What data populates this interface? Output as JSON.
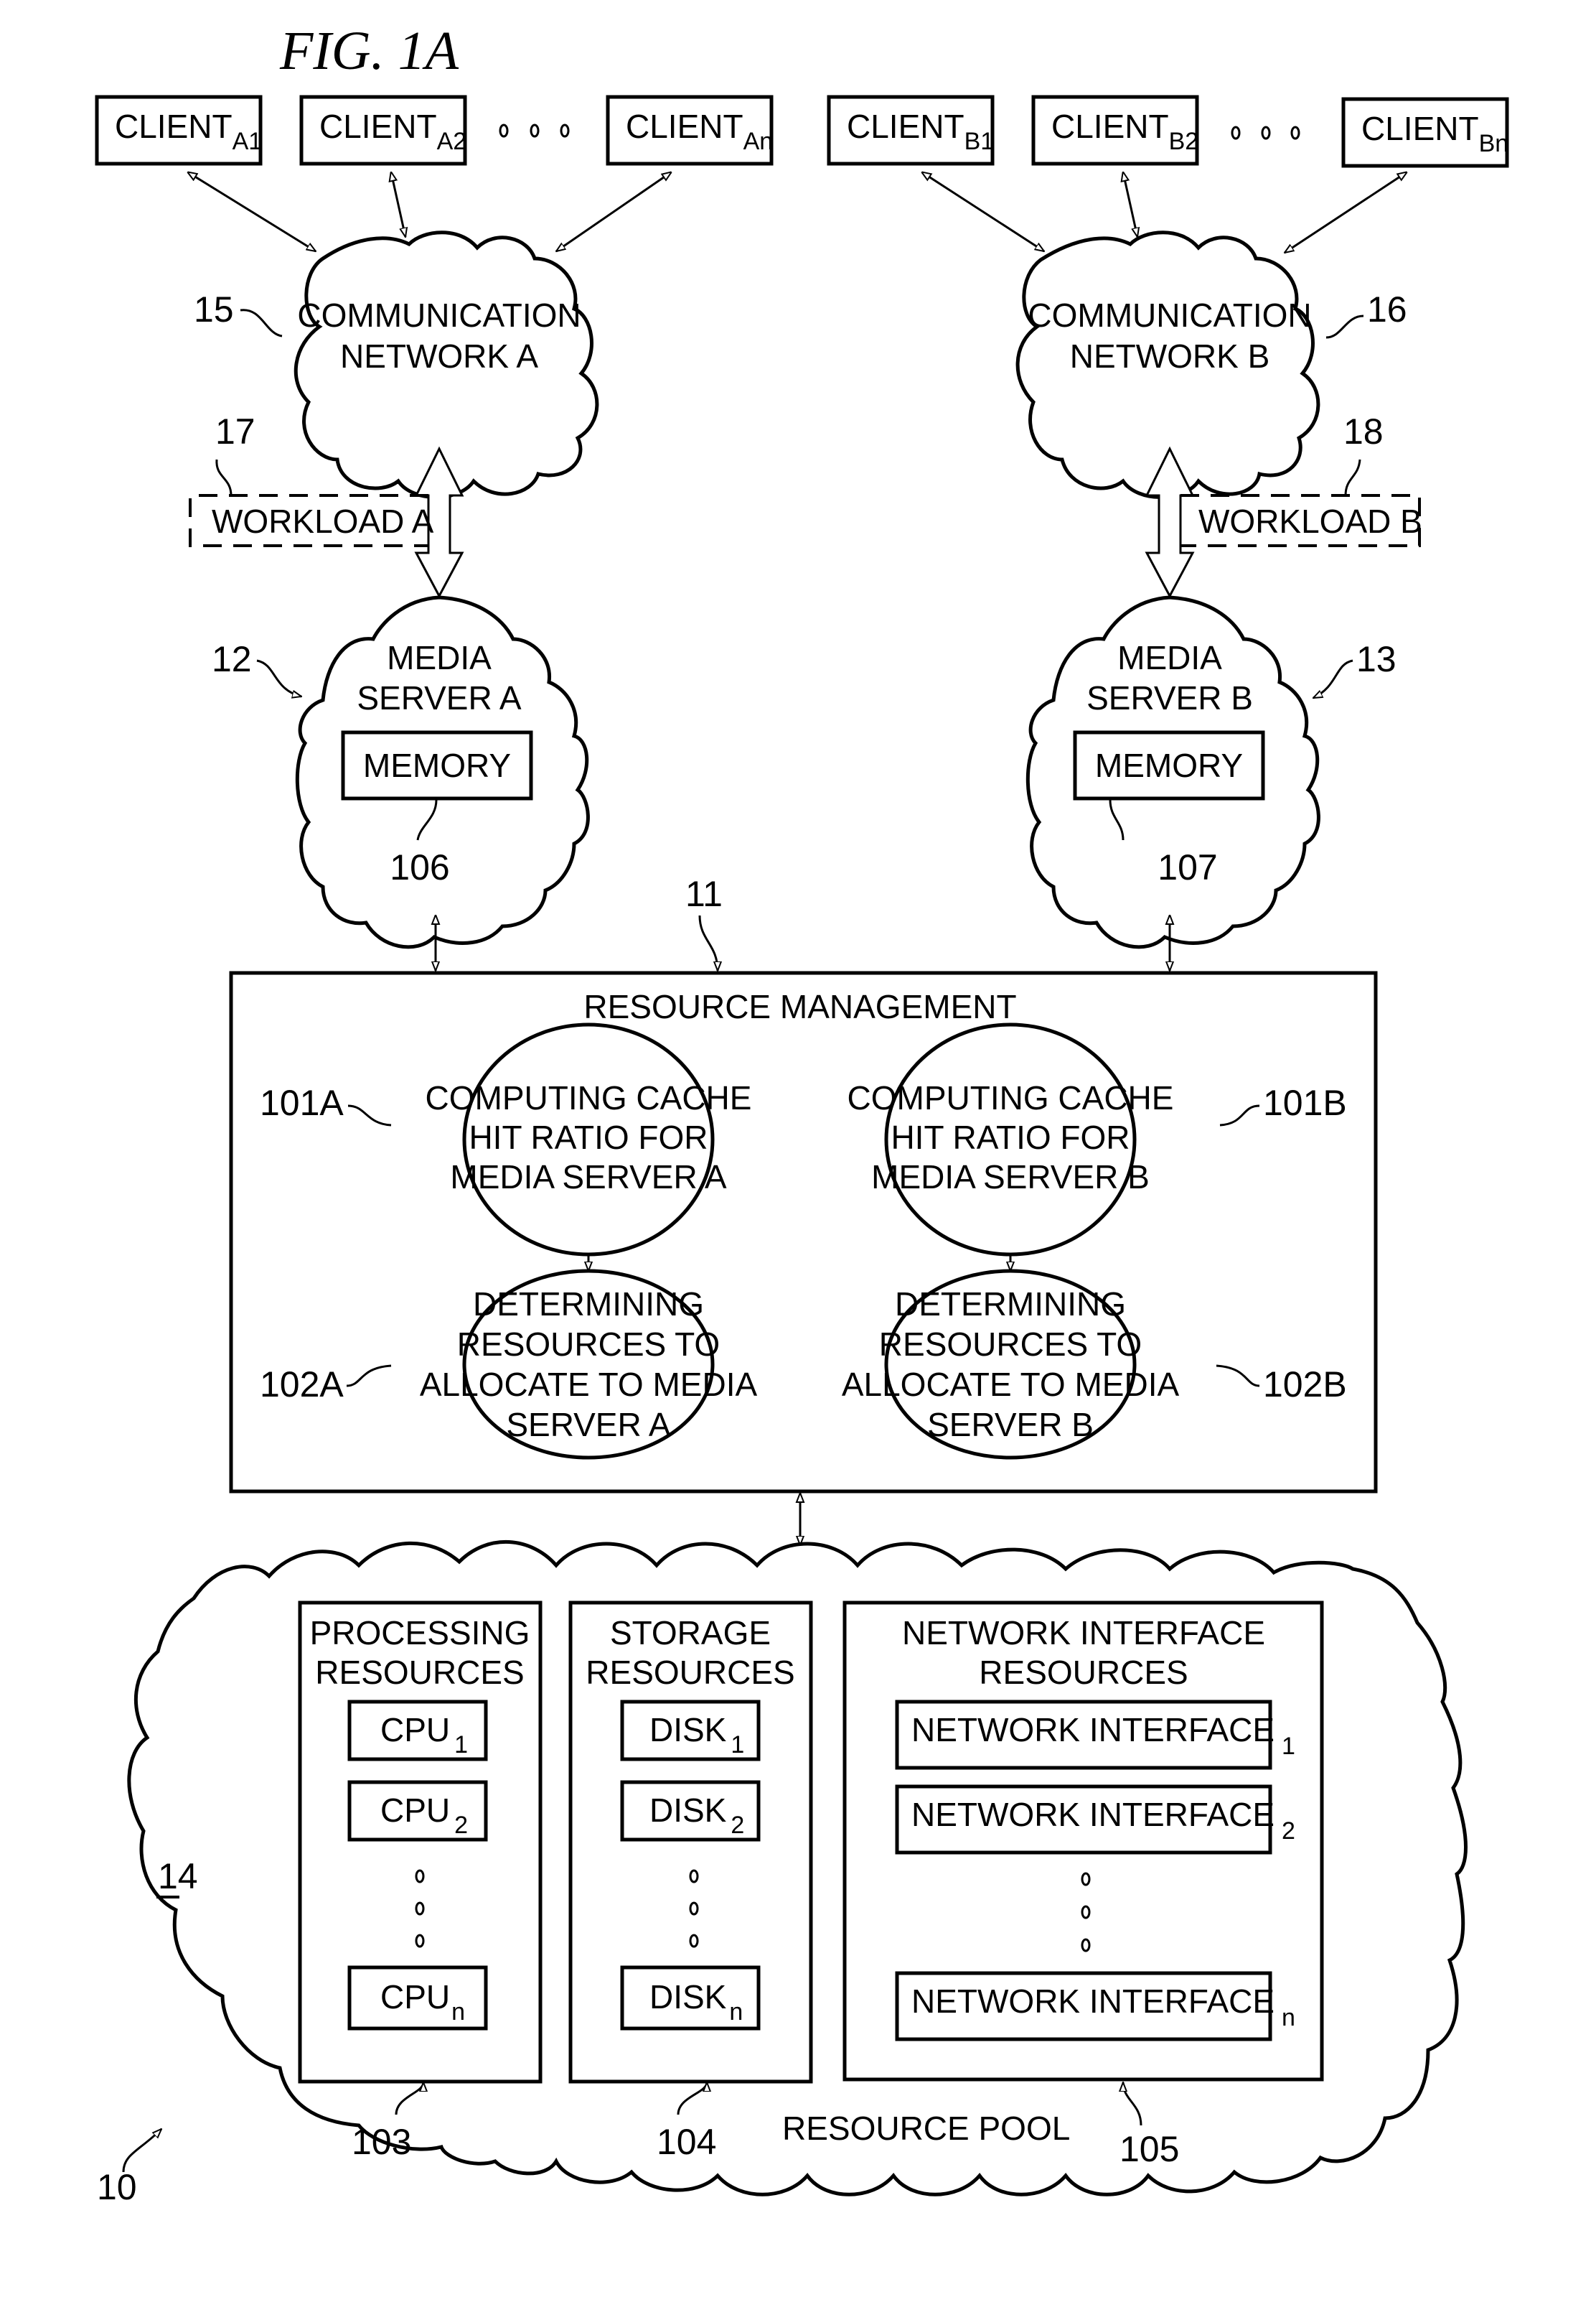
{
  "figure": {
    "title": "FIG. 1A"
  },
  "clients_a": [
    {
      "base": "CLIENT",
      "sub": "A1"
    },
    {
      "base": "CLIENT",
      "sub": "A2"
    },
    {
      "base": "CLIENT",
      "sub": "An"
    }
  ],
  "clients_b": [
    {
      "base": "CLIENT",
      "sub": "B1"
    },
    {
      "base": "CLIENT",
      "sub": "B2"
    },
    {
      "base": "CLIENT",
      "sub": "Bn"
    }
  ],
  "network_a": {
    "lines": [
      "COMMUNICATION",
      "NETWORK A"
    ],
    "ref": "15"
  },
  "network_b": {
    "lines": [
      "COMMUNICATION",
      "NETWORK B"
    ],
    "ref": "16"
  },
  "workload_a": {
    "label": "WORKLOAD A",
    "ref": "17"
  },
  "workload_b": {
    "label": "WORKLOAD B",
    "ref": "18"
  },
  "media_server_a": {
    "lines": [
      "MEDIA",
      "SERVER A"
    ],
    "ref": "12",
    "memory_label": "MEMORY",
    "memory_ref": "106"
  },
  "media_server_b": {
    "lines": [
      "MEDIA",
      "SERVER B"
    ],
    "ref": "13",
    "memory_label": "MEMORY",
    "memory_ref": "107"
  },
  "resource_management": {
    "title": "RESOURCE MANAGEMENT",
    "ref": "11",
    "steps": {
      "a1": {
        "lines": [
          "COMPUTING CACHE",
          "HIT RATIO FOR",
          "MEDIA SERVER A"
        ],
        "ref": "101A"
      },
      "b1": {
        "lines": [
          "COMPUTING CACHE",
          "HIT RATIO FOR",
          "MEDIA SERVER B"
        ],
        "ref": "101B"
      },
      "a2": {
        "lines": [
          "DETERMINING",
          "RESOURCES TO",
          "ALLOCATE TO MEDIA",
          "SERVER A"
        ],
        "ref": "102A"
      },
      "b2": {
        "lines": [
          "DETERMINING",
          "RESOURCES TO",
          "ALLOCATE TO MEDIA",
          "SERVER B"
        ],
        "ref": "102B"
      }
    }
  },
  "resource_pool": {
    "label": "RESOURCE POOL",
    "ref": "10",
    "inner_ref": "14",
    "processing": {
      "title": [
        "PROCESSING",
        "RESOURCES"
      ],
      "ref": "103",
      "items": [
        {
          "base": "CPU",
          "sub": "1"
        },
        {
          "base": "CPU",
          "sub": "2"
        },
        {
          "base": "CPU",
          "sub": "n"
        }
      ]
    },
    "storage": {
      "title": [
        "STORAGE",
        "RESOURCES"
      ],
      "ref": "104",
      "items": [
        {
          "base": "DISK",
          "sub": "1"
        },
        {
          "base": "DISK",
          "sub": "2"
        },
        {
          "base": "DISK",
          "sub": "n"
        }
      ]
    },
    "network": {
      "title": [
        "NETWORK INTERFACE",
        "RESOURCES"
      ],
      "ref": "105",
      "items": [
        {
          "base": "NETWORK INTERFACE",
          "sub": "1"
        },
        {
          "base": "NETWORK INTERFACE",
          "sub": "2"
        },
        {
          "base": "NETWORK INTERFACE",
          "sub": "n"
        }
      ]
    }
  }
}
